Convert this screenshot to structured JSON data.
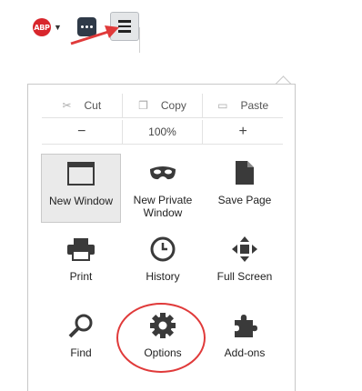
{
  "toolbar": {
    "abp_badge": "ABP",
    "abp_caret": "▼"
  },
  "edit_row": {
    "cut": "Cut",
    "copy": "Copy",
    "paste": "Paste"
  },
  "zoom_row": {
    "zoom_out": "−",
    "zoom_level": "100%",
    "zoom_in": "+"
  },
  "tiles": [
    {
      "label": "New Window",
      "icon": "window-icon"
    },
    {
      "label": "New Private Window",
      "icon": "mask-icon"
    },
    {
      "label": "Save Page",
      "icon": "page-icon"
    },
    {
      "label": "Print",
      "icon": "printer-icon"
    },
    {
      "label": "History",
      "icon": "clock-icon"
    },
    {
      "label": "Full Screen",
      "icon": "fullscreen-icon"
    },
    {
      "label": "Find",
      "icon": "magnifier-icon"
    },
    {
      "label": "Options",
      "icon": "gear-icon"
    },
    {
      "label": "Add-ons",
      "icon": "puzzle-icon"
    }
  ],
  "colors": {
    "annotation_red": "#e03a3a",
    "abp_red": "#d8262c"
  }
}
